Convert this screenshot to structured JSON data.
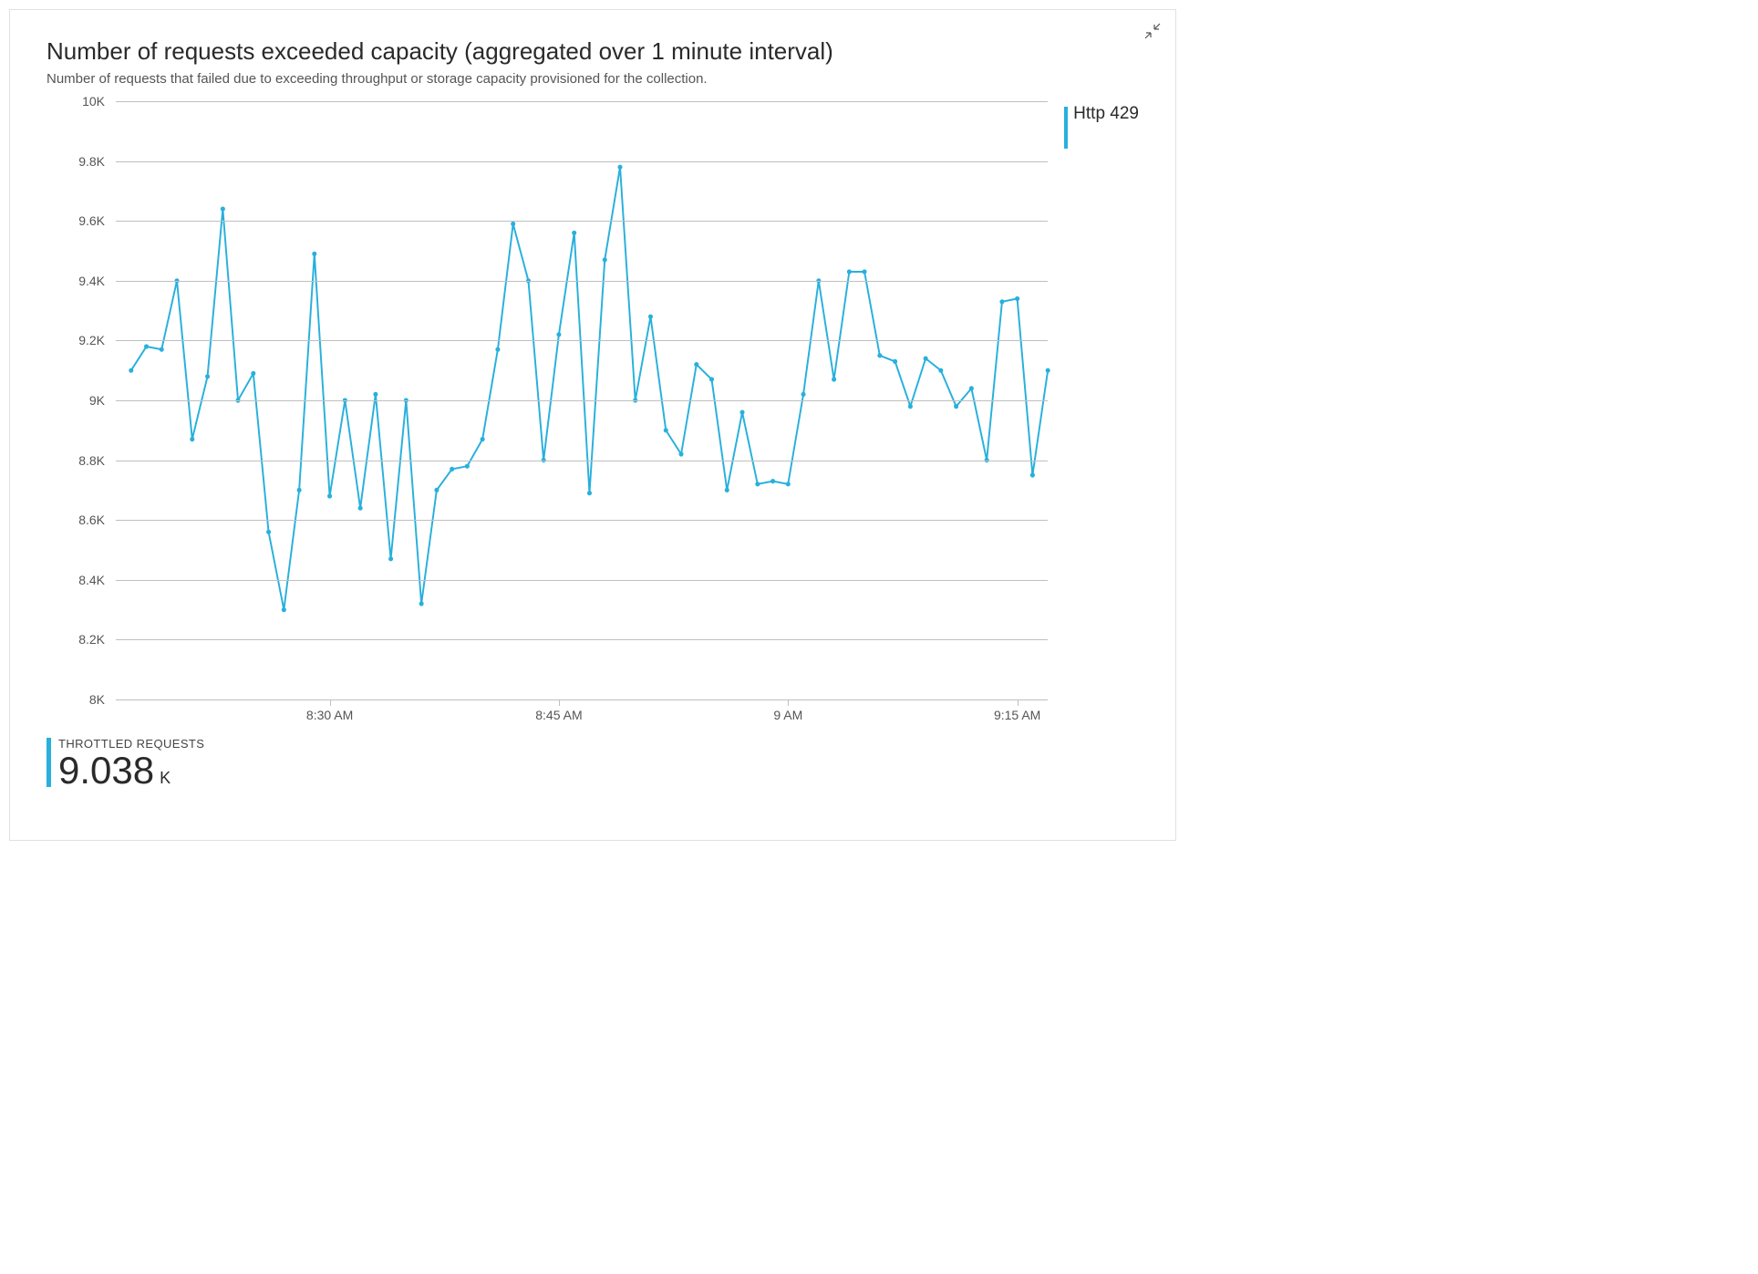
{
  "header": {
    "title": "Number of requests exceeded capacity (aggregated over 1 minute interval)",
    "subtitle": "Number of requests that failed due to exceeding throughput or storage capacity provisioned for the collection."
  },
  "legend": {
    "series_label": "Http 429"
  },
  "footer": {
    "label": "THROTTLED REQUESTS",
    "value": "9.038",
    "unit": "K"
  },
  "accent_color": "#28b0dc",
  "chart_data": {
    "type": "line",
    "title": "Number of requests exceeded capacity (aggregated over 1 minute interval)",
    "xlabel": "",
    "ylabel": "",
    "ylim": [
      8000,
      10000
    ],
    "y_ticks": [
      "8K",
      "8.2K",
      "8.4K",
      "8.6K",
      "8.8K",
      "9K",
      "9.2K",
      "9.4K",
      "9.6K",
      "9.8K",
      "10K"
    ],
    "x_ticks": [
      "8:30 AM",
      "8:45 AM",
      "9 AM",
      "9:15 AM"
    ],
    "x_range_minutes": [
      16,
      77
    ],
    "x_major_tick_minutes": [
      30,
      45,
      60,
      75
    ],
    "series": [
      {
        "name": "Http 429",
        "x_minutes": [
          17,
          18,
          19,
          20,
          21,
          22,
          23,
          24,
          25,
          26,
          27,
          28,
          29,
          30,
          31,
          32,
          33,
          34,
          35,
          36,
          37,
          38,
          39,
          40,
          41,
          42,
          43,
          44,
          45,
          46,
          47,
          48,
          49,
          50,
          51,
          52,
          53,
          54,
          55,
          56,
          57,
          58,
          59,
          60,
          61,
          62,
          63,
          64,
          65,
          66,
          67,
          68,
          69,
          70,
          71,
          72,
          73,
          74,
          75,
          76,
          77
        ],
        "values": [
          9100,
          9180,
          9170,
          9400,
          8870,
          9080,
          9640,
          9000,
          9090,
          8560,
          8300,
          8700,
          9490,
          8680,
          9000,
          8640,
          9020,
          8470,
          9000,
          8320,
          8700,
          8770,
          8780,
          8870,
          9170,
          9590,
          9400,
          8800,
          9220,
          9560,
          8690,
          9470,
          9780,
          9000,
          9280,
          8900,
          8820,
          9120,
          9070,
          8700,
          8960,
          8720,
          8730,
          8720,
          9020,
          9400,
          9070,
          9430,
          9430,
          9150,
          9130,
          8980,
          9140,
          9100,
          8980,
          9040,
          8800,
          9330,
          9340,
          8750,
          9100
        ]
      }
    ]
  }
}
